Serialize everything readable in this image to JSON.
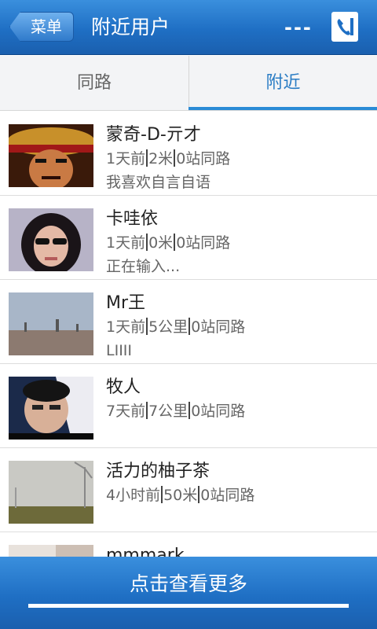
{
  "header": {
    "back_label": "菜单",
    "title": "附近用户",
    "more_label": "---"
  },
  "tabs": [
    {
      "label": "同路",
      "active": false
    },
    {
      "label": "附近",
      "active": true
    }
  ],
  "users": [
    {
      "name": "蒙奇-D-亓才",
      "time": "1天前",
      "distance": "2米",
      "route": "0站同路",
      "status": "我喜欢自言自语"
    },
    {
      "name": "卡哇依",
      "time": "1天前",
      "distance": "0米",
      "route": "0站同路",
      "status": "正在输入..."
    },
    {
      "name": "Mr王",
      "time": "1天前",
      "distance": "5公里",
      "route": "0站同路",
      "status": "LIIII"
    },
    {
      "name": "牧人",
      "time": "7天前",
      "distance": "7公里",
      "route": "0站同路",
      "status": ""
    },
    {
      "name": "活力的柚子茶",
      "time": "4小时前",
      "distance": "50米",
      "route": "0站同路",
      "status": ""
    },
    {
      "name": "mmmark",
      "time": "",
      "distance": "",
      "route": "",
      "status": ""
    }
  ],
  "footer": {
    "more_label": "点击查看更多"
  },
  "colors": {
    "header_blue": "#1f6fc4",
    "tab_active": "#2a7cc4",
    "tab_indicator": "#2a8bd6"
  }
}
